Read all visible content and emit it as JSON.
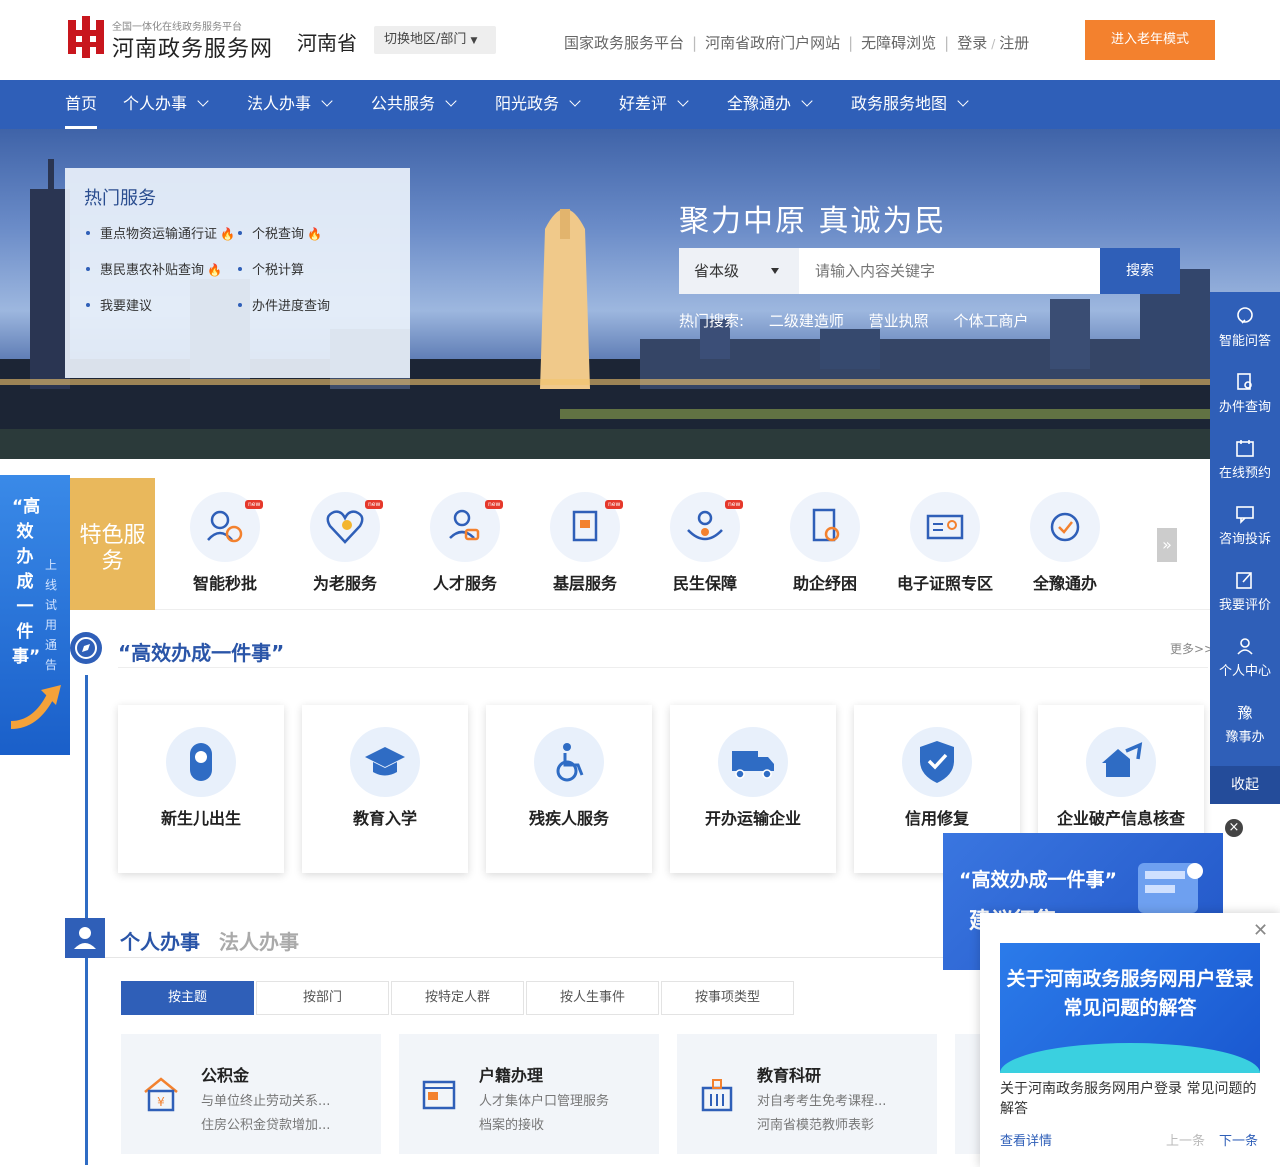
{
  "header": {
    "logo_sub": "全国一体化在线政务服务平台",
    "logo_main": "河南政务服务网",
    "province": "河南省",
    "switch_label": "切换地区/部门",
    "links": [
      "国家政务服务平台",
      "河南省政府门户网站",
      "无障碍浏览",
      "登录",
      "注册"
    ],
    "elder_mode": "进入老年模式"
  },
  "nav": {
    "items": [
      "首页",
      "个人办事",
      "法人办事",
      "公共服务",
      "阳光政务",
      "好差评",
      "全豫通办",
      "政务服务地图"
    ]
  },
  "banner": {
    "hot_title": "热门服务",
    "hot_items": [
      "重点物资运输通行证",
      "个税查询",
      "惠民惠农补贴查询",
      "个税计算",
      "我要建议",
      "办件进度查询"
    ],
    "slogan": "聚力中原   真诚为民",
    "search_level": "省本级",
    "search_placeholder": "请输入内容关键字",
    "search_button": "搜索",
    "hot_search_label": "热门搜索:",
    "hot_search_items": [
      "二级建造师",
      "营业执照",
      "个体工商户"
    ]
  },
  "right_sidebar": {
    "items": [
      "智能问答",
      "办件查询",
      "在线预约",
      "咨询投诉",
      "我要评价",
      "个人中心",
      "豫事办"
    ],
    "collapse": "收起"
  },
  "left_float": {
    "big": "“高效办成一件事”",
    "small": "上线试用通告"
  },
  "features": {
    "tag": "特色服务",
    "items": [
      "智能秒批",
      "为老服务",
      "人才服务",
      "基层服务",
      "民生保障",
      "助企纾困",
      "电子证照专区",
      "全豫通办"
    ],
    "new_badge": "new"
  },
  "gaoxiao": {
    "title": "“高效办成一件事”",
    "more": "更多>>",
    "cards": [
      "新生儿出生",
      "教育入学",
      "残疾人服务",
      "开办运输企业",
      "信用修复",
      "企业破产信息核查"
    ]
  },
  "personal": {
    "title": "个人办事",
    "title2": "法人办事",
    "tabs": [
      "按主题",
      "按部门",
      "按特定人群",
      "按人生事件",
      "按事项类型"
    ],
    "services": [
      {
        "title": "公积金",
        "l1": "与单位终止劳动关系...",
        "l2": "住房公积金贷款增加..."
      },
      {
        "title": "户籍办理",
        "l1": "人才集体户口管理服务",
        "l2": "档案的接收"
      },
      {
        "title": "教育科研",
        "l1": "对自考考生免考课程...",
        "l2": "河南省模范教师表彰"
      }
    ]
  },
  "popup1": {
    "title": "“高效办成一件事”",
    "sub": "建议征集"
  },
  "popup2": {
    "img_title": "关于河南政务服务网用户登录常见问题的解答",
    "caption": "关于河南政务服务网用户登录 常见问题的解答",
    "more": "查看详情",
    "prev": "上一条",
    "next": "下一条"
  },
  "colors": {
    "primary": "#2f5fb8",
    "orange": "#f3812e",
    "gold": "#e9b85c"
  }
}
